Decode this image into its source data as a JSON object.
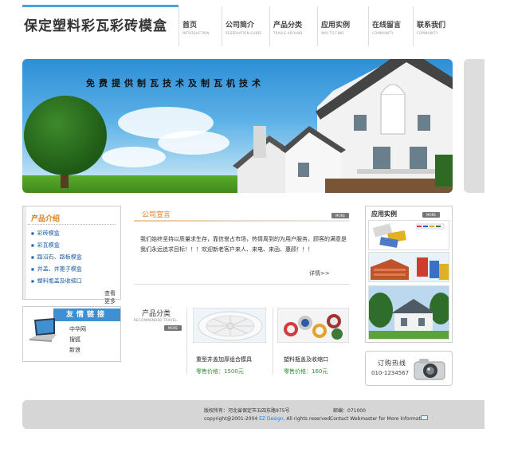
{
  "header": {
    "site_title": "保定塑料彩瓦彩砖模盒",
    "nav": [
      {
        "label": "首页",
        "en": "INTRODUCTION"
      },
      {
        "label": "公司简介",
        "en": "RESERVATION GUIDE"
      },
      {
        "label": "产品分类",
        "en": "TRAVLE AROUND"
      },
      {
        "label": "应用实例",
        "en": "WAY TO FIND"
      },
      {
        "label": "在线留言",
        "en": "COMMUNITY"
      },
      {
        "label": "联系我们",
        "en": "COMMUNITY"
      }
    ]
  },
  "banner": {
    "slogan": "免费提供制瓦技术及制瓦机技术"
  },
  "product_intro": {
    "title": "产品介绍",
    "items": [
      "彩砖模盒",
      "彩瓦模盒",
      "路沿石、路板模盒",
      "井盖、井篦子模盒",
      "塑料瓶盖及收缩口"
    ],
    "more": "查看更多"
  },
  "links": {
    "title": "友情链接",
    "items": [
      "中华网",
      "搜狐",
      "新浪"
    ]
  },
  "company": {
    "title": "公司宣言",
    "more": "MORE",
    "text": "我们始终坚持以质量求生存，靠信誉占市场，热情周到的为用户服务，顾客的满意是我们永远追求目标！！！欢迎新老客户来人、来电、来函、惠顾！！！",
    "details": "详情>>"
  },
  "products": {
    "title": "产品分类",
    "en": "RECOMMENDED TRAVEL",
    "more": "MORE",
    "items": [
      {
        "name": "重型井盖加厚组合模具",
        "price": "零售价格：1500元"
      },
      {
        "name": "塑料瓶盖及收缩口",
        "price": "零售价格：160元"
      }
    ]
  },
  "cases": {
    "title": "应用实例",
    "more": "MORE"
  },
  "hotline": {
    "label": "订购热线",
    "phone": "010-1234567"
  },
  "footer": {
    "owner": "版权所有：河北省保定市五四东路975号",
    "postcode": "邮编：071000",
    "copyright_prefix": "copyright@2001-2004",
    "brand": "EZ Design,",
    "copyright_suffix": "All rights reserved.",
    "contact": "Contact Webmaster for More Information"
  },
  "colors": {
    "accent_orange": "#e07b1e",
    "link_blue": "#1b5fa8",
    "price_green": "#2e8f3a",
    "header_blue": "#4aa3df"
  }
}
